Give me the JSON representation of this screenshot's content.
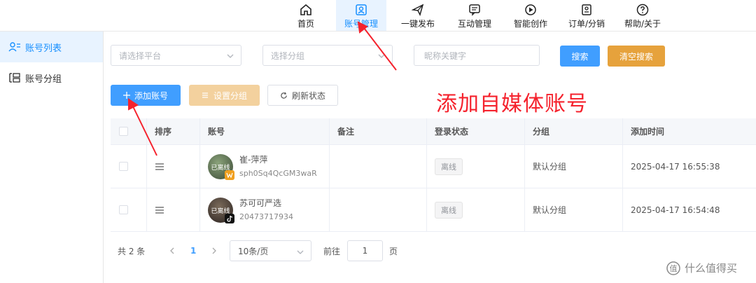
{
  "nav": {
    "items": [
      {
        "label": "首页",
        "icon": "home-icon"
      },
      {
        "label": "账号管理",
        "icon": "account-icon"
      },
      {
        "label": "一键发布",
        "icon": "send-icon"
      },
      {
        "label": "互动管理",
        "icon": "chat-icon"
      },
      {
        "label": "智能创作",
        "icon": "ai-play-icon"
      },
      {
        "label": "订单/分销",
        "icon": "order-icon"
      },
      {
        "label": "帮助/关于",
        "icon": "help-icon"
      }
    ],
    "active_index": 1
  },
  "sidebar": {
    "items": [
      {
        "label": "账号列表",
        "icon": "user-list-icon"
      },
      {
        "label": "账号分组",
        "icon": "group-icon"
      }
    ]
  },
  "filters": {
    "platform_placeholder": "请选择平台",
    "group_placeholder": "选择分组",
    "keyword_placeholder": "昵称关键字",
    "search_label": "搜索",
    "clear_label": "清空搜索"
  },
  "actions": {
    "add_label": "添加账号",
    "set_group_label": "设置分组",
    "refresh_label": "刷新状态"
  },
  "annotation": "添加自媒体账号",
  "table": {
    "headers": [
      "排序",
      "账号",
      "备注",
      "登录状态",
      "分组",
      "添加时间"
    ],
    "rows": [
      {
        "name": "崔-萍萍",
        "id": "sph0Sq4QcGM3waR",
        "avatar_caption": "已离线",
        "note": "",
        "status": "离线",
        "group": "默认分组",
        "time": "2025-04-17 16:55:38",
        "platform_icon": "wechat-channels-icon"
      },
      {
        "name": "苏可可严选",
        "id": "20473717934",
        "avatar_caption": "已离线",
        "note": "",
        "status": "离线",
        "group": "默认分组",
        "time": "2025-04-17 16:54:48",
        "platform_icon": "douyin-icon"
      }
    ]
  },
  "pager": {
    "total": "共 2 条",
    "current": "1",
    "size": "10条/页",
    "goto_label": "前往",
    "goto_value": "1",
    "page_unit": "页"
  },
  "watermark": "什么值得买",
  "colors": {
    "primary": "#409eff",
    "warning": "#e6a23c",
    "annotation": "#f5222d"
  }
}
